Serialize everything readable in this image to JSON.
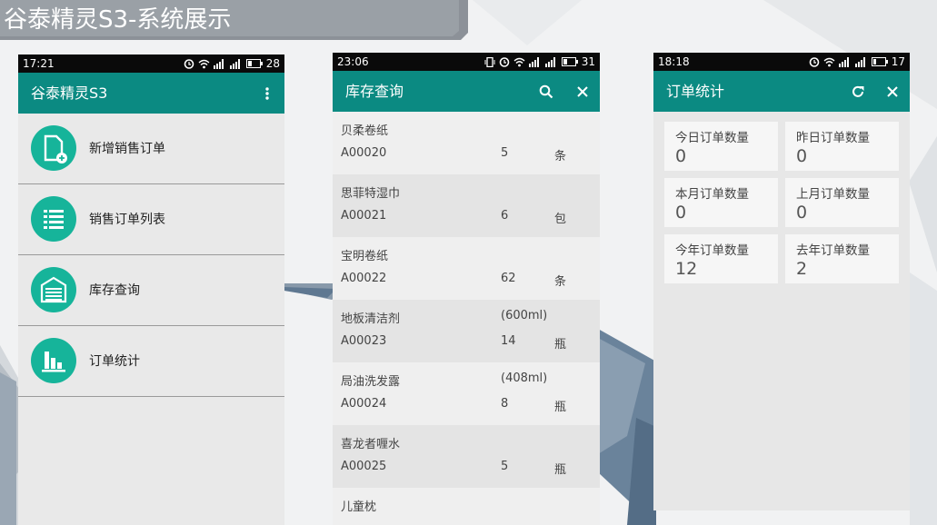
{
  "banner": {
    "title": "谷泰精灵S3-系统展示"
  },
  "colors": {
    "toolbar": "#0b8a82",
    "accent": "#16b49a",
    "statusbar": "#0a0a0a"
  },
  "phone1": {
    "status": {
      "time": "17:21",
      "battery": "28"
    },
    "toolbar": {
      "title": "谷泰精灵S3",
      "menu_icon": "more-vert-icon"
    },
    "menu": [
      {
        "label": "新增销售订单",
        "icon": "new-order-icon"
      },
      {
        "label": "销售订单列表",
        "icon": "list-icon"
      },
      {
        "label": "库存查询",
        "icon": "warehouse-icon"
      },
      {
        "label": "订单统计",
        "icon": "bar-chart-icon"
      }
    ]
  },
  "phone2": {
    "status": {
      "time": "23:06",
      "battery": "31"
    },
    "toolbar": {
      "title": "库存查询",
      "search_icon": "search-icon",
      "close_icon": "close-icon"
    },
    "items": [
      {
        "name": "贝柔卷纸",
        "code": "A00020",
        "spec": "",
        "qty": "5",
        "unit": "条"
      },
      {
        "name": "思菲特湿巾",
        "code": "A00021",
        "spec": "",
        "qty": "6",
        "unit": "包"
      },
      {
        "name": "宝明卷纸",
        "code": "A00022",
        "spec": "",
        "qty": "62",
        "unit": "条"
      },
      {
        "name": "地板清洁剂",
        "code": "A00023",
        "spec": "(600ml)",
        "qty": "14",
        "unit": "瓶"
      },
      {
        "name": "局油洗发露",
        "code": "A00024",
        "spec": "(408ml)",
        "qty": "8",
        "unit": "瓶"
      },
      {
        "name": "喜龙者喱水",
        "code": "A00025",
        "spec": "",
        "qty": "5",
        "unit": "瓶"
      },
      {
        "name": "儿童枕",
        "code": "",
        "spec": "",
        "qty": "",
        "unit": ""
      }
    ]
  },
  "phone3": {
    "status": {
      "time": "18:18",
      "battery": "17"
    },
    "toolbar": {
      "title": "订单统计",
      "refresh_icon": "refresh-icon",
      "close_icon": "close-icon"
    },
    "stats": [
      {
        "label": "今日订单数量",
        "value": "0"
      },
      {
        "label": "昨日订单数量",
        "value": "0"
      },
      {
        "label": "本月订单数量",
        "value": "0"
      },
      {
        "label": "上月订单数量",
        "value": "0"
      },
      {
        "label": "今年订单数量",
        "value": "12"
      },
      {
        "label": "去年订单数量",
        "value": "2"
      }
    ]
  }
}
